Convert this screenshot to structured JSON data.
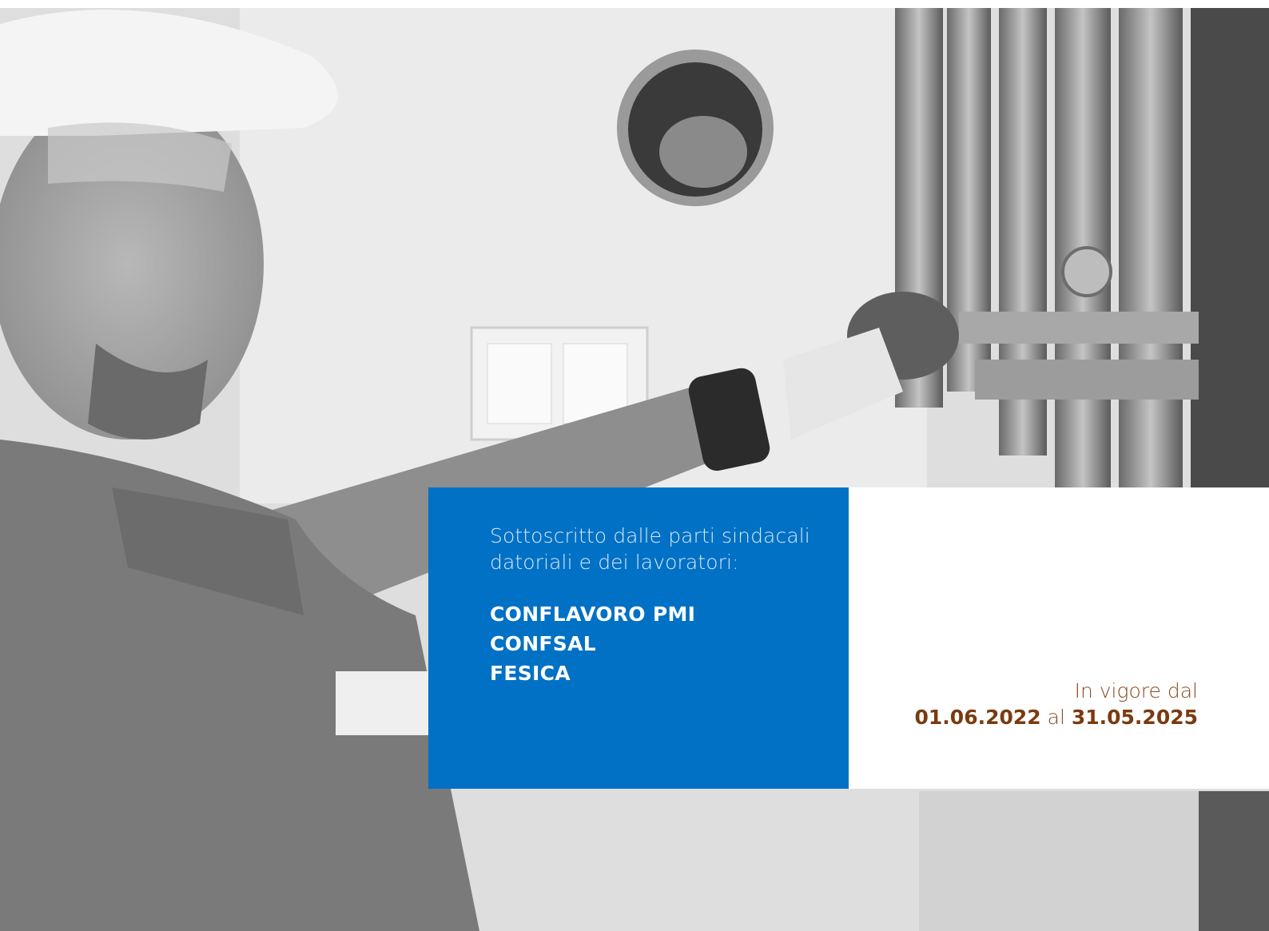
{
  "photo": {
    "description_icon": "worker-plumbing-photo"
  },
  "signatories": {
    "intro": "Sottoscritto dalle parti sindacali datoriali e dei lavoratori:",
    "parties": [
      "CONFLAVORO PMI",
      "CONFSAL",
      "FESICA"
    ]
  },
  "validity": {
    "label": "In vigore dal",
    "start": "01.06.2022",
    "connector": "al",
    "end": "31.05.2025"
  },
  "colors": {
    "panel_blue": "#0071c5",
    "date_brown": "#7a3a10"
  }
}
